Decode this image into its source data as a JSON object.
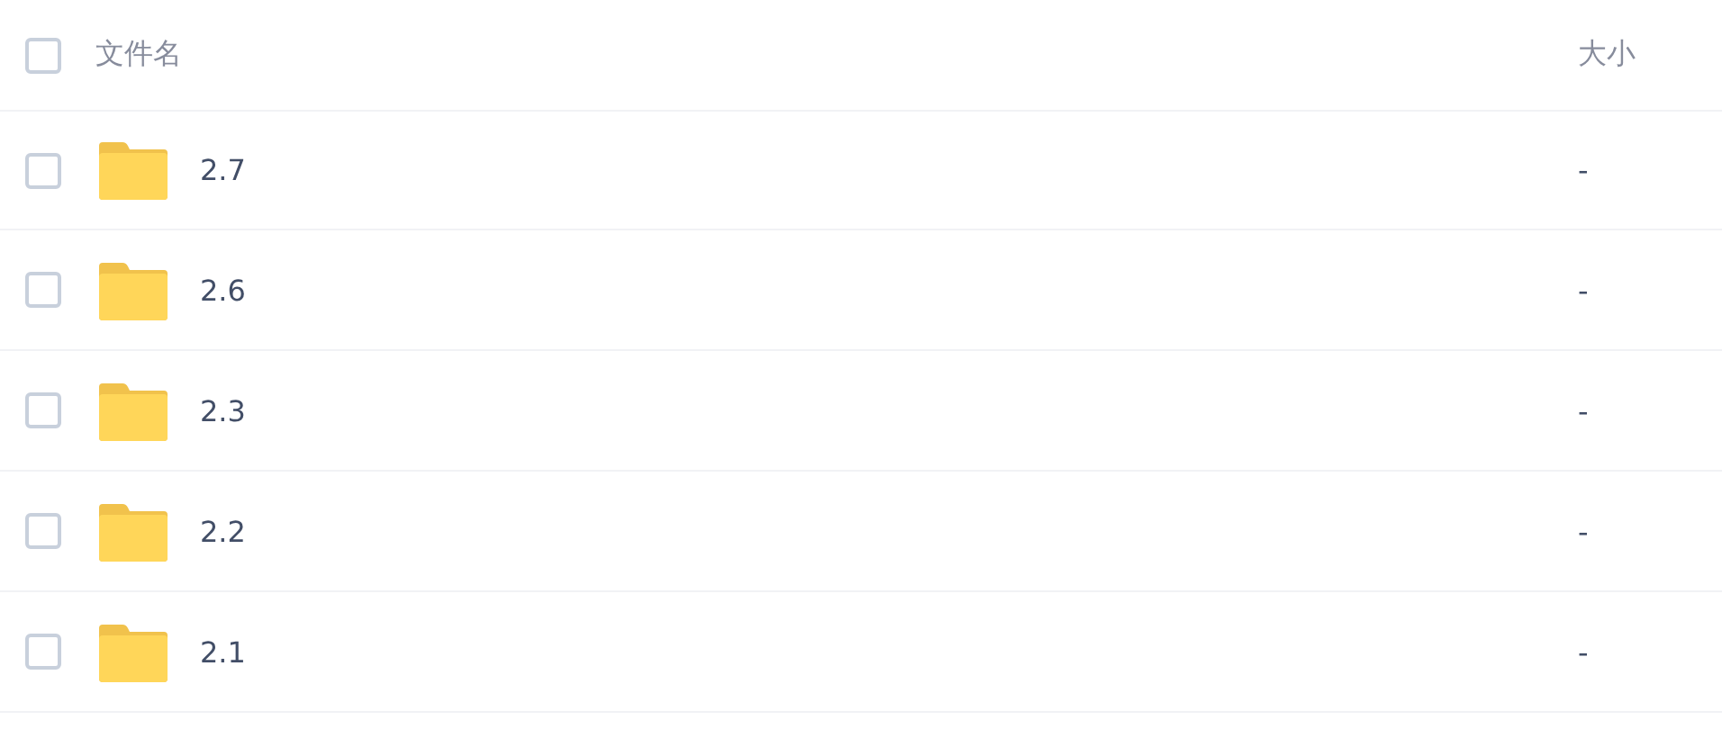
{
  "table": {
    "select_all": {
      "checked": false
    },
    "columns": [
      "文件名",
      "大小"
    ],
    "rows": [
      {
        "name": "2.7",
        "size": "-",
        "checked": false
      },
      {
        "name": "2.6",
        "size": "-",
        "checked": false
      },
      {
        "name": "2.3",
        "size": "-",
        "checked": false
      },
      {
        "name": "2.2",
        "size": "-",
        "checked": false
      },
      {
        "name": "2.1",
        "size": "-",
        "checked": false
      }
    ]
  }
}
